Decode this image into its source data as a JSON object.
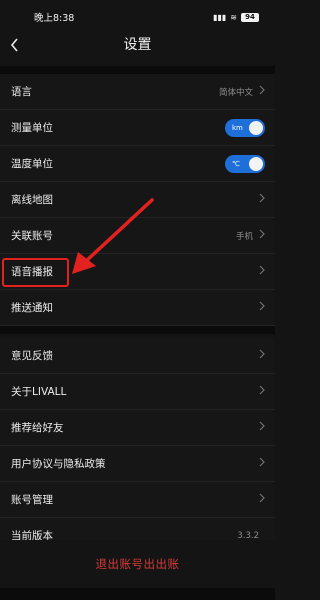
{
  "status_bar": {
    "time": "晚上8:38",
    "signal": "▮▮▮",
    "wifi": "≋",
    "battery": "94"
  },
  "header": {
    "title": "设置"
  },
  "section1": [
    {
      "label": "语言",
      "value": "简体中文",
      "control": "chevron"
    },
    {
      "label": "测量单位",
      "toggle_text": "km",
      "control": "toggle"
    },
    {
      "label": "温度单位",
      "toggle_text": "℃",
      "control": "toggle"
    },
    {
      "label": "离线地图",
      "control": "chevron"
    },
    {
      "label": "关联账号",
      "value": "手机",
      "control": "chevron"
    },
    {
      "label": "语音播报",
      "control": "chevron"
    },
    {
      "label": "推送通知",
      "control": "chevron"
    }
  ],
  "section2": [
    {
      "label": "意见反馈"
    },
    {
      "label": "关于LIVALL"
    },
    {
      "label": "推荐给好友"
    },
    {
      "label": "用户协议与隐私政策"
    },
    {
      "label": "账号管理"
    },
    {
      "label": "当前版本",
      "value": "3.3.2"
    }
  ],
  "footer": {
    "logout_label": "退出账号出出账"
  },
  "colors": {
    "accent": "#1e6fd9",
    "highlight": "#e3221f",
    "logout": "#d53a3a"
  },
  "icons": {
    "back": "chevron-left-icon",
    "row_arrow": "chevron-right-icon"
  }
}
